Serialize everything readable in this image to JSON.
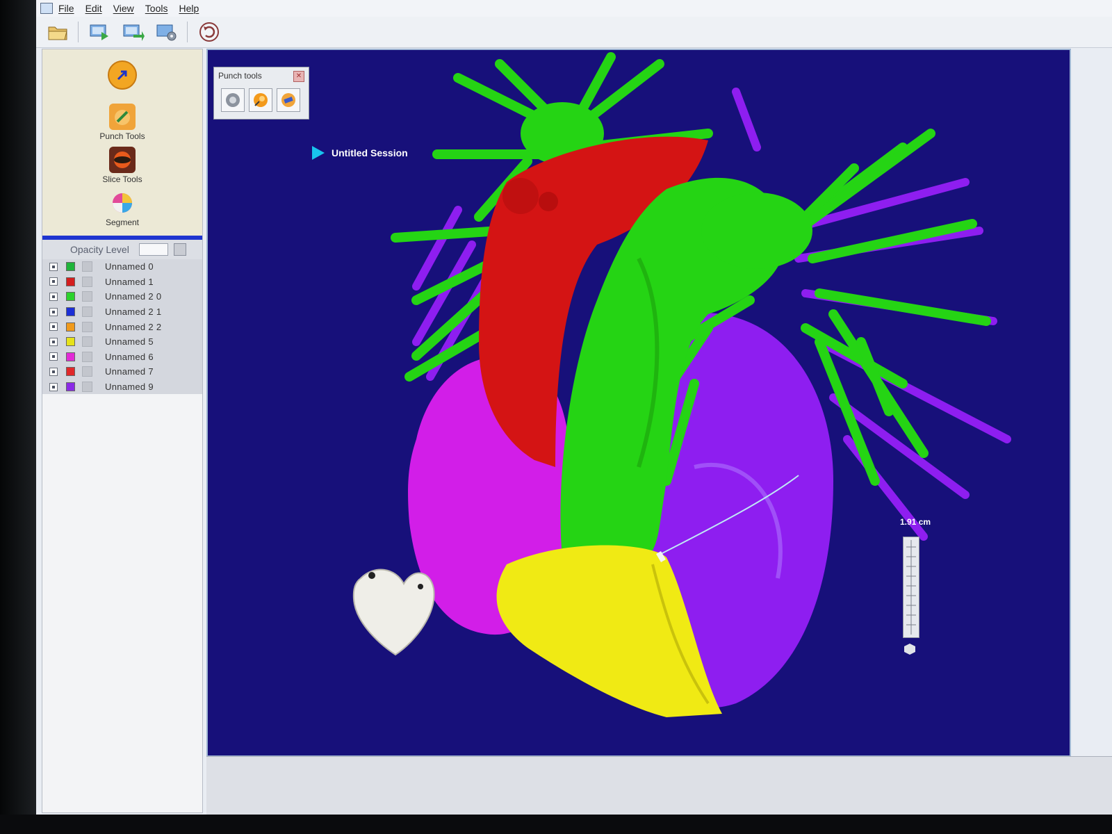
{
  "menu": {
    "items": [
      "File",
      "Edit",
      "View",
      "Tools",
      "Help"
    ]
  },
  "toolbar": {
    "icons": [
      "open-folder-icon",
      "import-icon",
      "export-icon",
      "settings-icon",
      "undo-icon"
    ]
  },
  "tools": {
    "pointer_icon": "arrow-pointer-icon",
    "punch_label": "Punch Tools",
    "slice_label": "Slice Tools",
    "segment_label": "Segment"
  },
  "opacity": {
    "label": "Opacity Level"
  },
  "layers": [
    {
      "name": "Unnamed 0",
      "color": "#1fb43a"
    },
    {
      "name": "Unnamed 1",
      "color": "#d41e1e"
    },
    {
      "name": "Unnamed 2 0",
      "color": "#2cd22c"
    },
    {
      "name": "Unnamed 2 1",
      "color": "#1c2fd6"
    },
    {
      "name": "Unnamed 2 2",
      "color": "#f09a1c"
    },
    {
      "name": "Unnamed 5",
      "color": "#e6e21a"
    },
    {
      "name": "Unnamed 6",
      "color": "#e22ad6"
    },
    {
      "name": "Unnamed 7",
      "color": "#e0282a"
    },
    {
      "name": "Unnamed 9",
      "color": "#8a2ae6"
    }
  ],
  "punch_tools": {
    "title": "Punch tools",
    "buttons": [
      "circle-punch-icon",
      "sphere-punch-icon",
      "brush-punch-icon"
    ]
  },
  "session": {
    "title": "Untitled Session"
  },
  "scale": {
    "label": "1.91 cm"
  },
  "colors": {
    "viewport_bg": "#17107a",
    "aorta": "#d41414",
    "pulmonary": "#25d414",
    "right_ventricle": "#f0ea14",
    "right_atrium": "#d21ee8",
    "left_chambers": "#8e1ef0"
  }
}
